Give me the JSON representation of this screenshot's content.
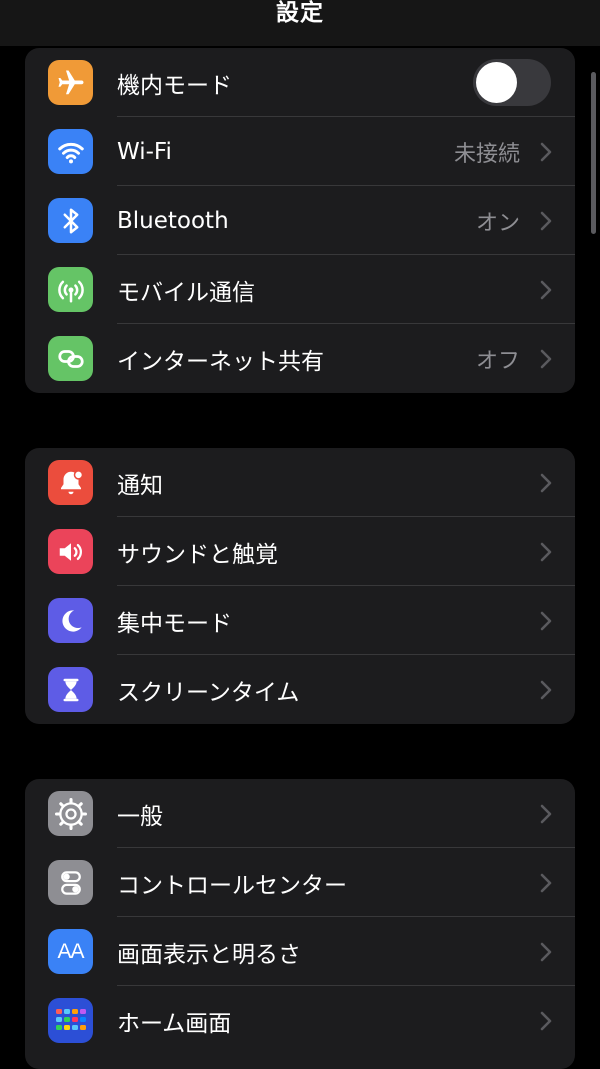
{
  "header": {
    "title": "設定"
  },
  "colors": {
    "airplane": "#f09a37",
    "wifi": "#3a82f6",
    "bluetooth": "#3a82f6",
    "cellular": "#65c466",
    "hotspot": "#65c466",
    "notifications": "#eb4d3d",
    "sounds": "#eb445a",
    "focus": "#5e5ce6",
    "screentime": "#5e5ce6",
    "general": "#8e8e93",
    "control_center": "#8e8e93",
    "display": "#3a82f6",
    "home_screen": "#2c4fd6"
  },
  "groups": [
    {
      "rows": [
        {
          "label": "機内モード",
          "icon": "airplane-icon",
          "control": "toggle",
          "toggle_on": false
        },
        {
          "label": "Wi-Fi",
          "icon": "wifi-icon",
          "value": "未接続"
        },
        {
          "label": "Bluetooth",
          "icon": "bluetooth-icon",
          "value": "オン"
        },
        {
          "label": "モバイル通信",
          "icon": "antenna-icon",
          "value": ""
        },
        {
          "label": "インターネット共有",
          "icon": "link-icon",
          "value": "オフ"
        }
      ]
    },
    {
      "rows": [
        {
          "label": "通知",
          "icon": "bell-icon"
        },
        {
          "label": "サウンドと触覚",
          "icon": "speaker-icon"
        },
        {
          "label": "集中モード",
          "icon": "moon-icon"
        },
        {
          "label": "スクリーンタイム",
          "icon": "hourglass-icon"
        }
      ]
    },
    {
      "rows": [
        {
          "label": "一般",
          "icon": "gear-icon"
        },
        {
          "label": "コントロールセンター",
          "icon": "switches-icon"
        },
        {
          "label": "画面表示と明るさ",
          "icon": "text-size-icon",
          "icon_text": "AA"
        },
        {
          "label": "ホーム画面",
          "icon": "app-grid-icon"
        }
      ]
    }
  ]
}
